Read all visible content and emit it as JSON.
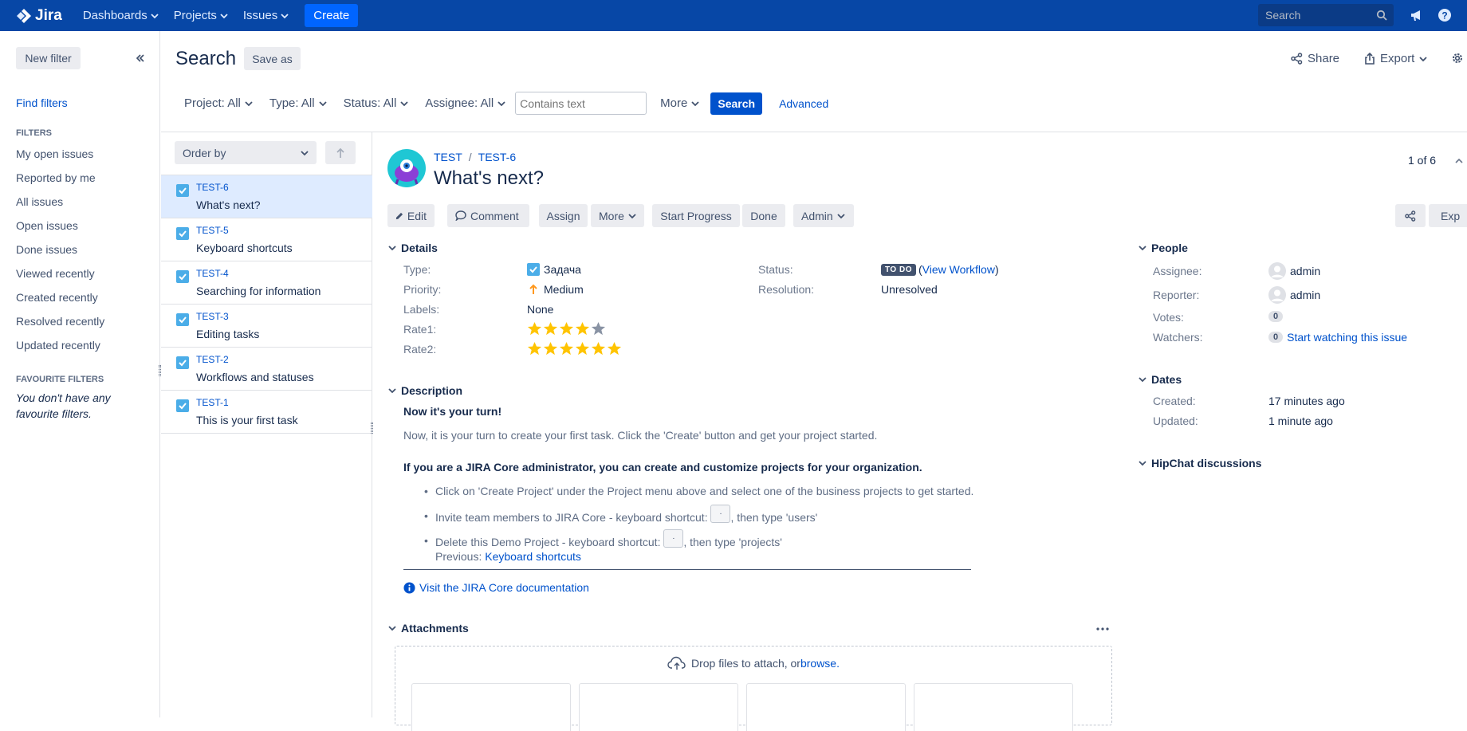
{
  "topnav": {
    "logo": "Jira",
    "dashboards": "Dashboards",
    "projects": "Projects",
    "issues": "Issues",
    "create": "Create",
    "search_placeholder": "Search"
  },
  "sidebar": {
    "new_filter": "New filter",
    "find_filters": "Find filters",
    "filters_heading": "FILTERS",
    "items": [
      "My open issues",
      "Reported by me",
      "All issues",
      "Open issues",
      "Done issues",
      "Viewed recently",
      "Created recently",
      "Resolved recently",
      "Updated recently"
    ],
    "favourite_heading": "FAVOURITE FILTERS",
    "favourite_empty": "You don't have any favourite filters."
  },
  "search": {
    "title": "Search",
    "save_as": "Save as",
    "share": "Share",
    "export": "Export",
    "filters": {
      "project": "Project: All",
      "type": "Type: All",
      "status": "Status: All",
      "assignee": "Assignee: All",
      "text_placeholder": "Contains text",
      "more": "More",
      "search": "Search",
      "advanced": "Advanced"
    },
    "order_by": "Order by"
  },
  "issues": [
    {
      "key": "TEST-6",
      "summary": "What's next?",
      "selected": true
    },
    {
      "key": "TEST-5",
      "summary": "Keyboard shortcuts",
      "selected": false
    },
    {
      "key": "TEST-4",
      "summary": "Searching for information",
      "selected": false
    },
    {
      "key": "TEST-3",
      "summary": "Editing tasks",
      "selected": false
    },
    {
      "key": "TEST-2",
      "summary": "Workflows and statuses",
      "selected": false
    },
    {
      "key": "TEST-1",
      "summary": "This is your first task",
      "selected": false
    }
  ],
  "issue": {
    "project": "TEST",
    "key": "TEST-6",
    "title": "What's next?",
    "pager": "1 of 6",
    "actions": {
      "edit": "Edit",
      "comment": "Comment",
      "assign": "Assign",
      "more": "More",
      "start_progress": "Start Progress",
      "done": "Done",
      "admin": "Admin",
      "export_partial": "Exp"
    },
    "details": {
      "heading": "Details",
      "type_label": "Type:",
      "type_value": "Задача",
      "priority_label": "Priority:",
      "priority_value": "Medium",
      "labels_label": "Labels:",
      "labels_value": "None",
      "rate1_label": "Rate1:",
      "rate1_value": 4,
      "rate2_label": "Rate2:",
      "rate2_value": 6,
      "status_label": "Status:",
      "status_value": "TO DO",
      "view_workflow": "View Workflow",
      "resolution_label": "Resolution:",
      "resolution_value": "Unresolved"
    },
    "description": {
      "heading": "Description",
      "line1": "Now it's your turn!",
      "line2": "Now, it is your turn to create your first task. Click the 'Create' button and get your project started.",
      "line3": "If you are a JIRA Core administrator, you can create and customize projects for your organization.",
      "bullet1": "Click on 'Create Project' under the Project menu above and select one of the business projects to get started.",
      "bullet2_pre": "Invite team members to JIRA Core - keyboard shortcut: ",
      "bullet2_post": ", then type 'users'",
      "bullet3_pre": "Delete this Demo Project - keyboard shortcut: ",
      "bullet3_post": ", then type 'projects'",
      "kbd": ".",
      "previous_label": "Previous: ",
      "previous_link": "Keyboard shortcuts",
      "doc_link": "Visit the JIRA Core documentation"
    },
    "attachments": {
      "heading": "Attachments",
      "drop_text": "Drop files to attach, or ",
      "browse": "browse."
    },
    "people": {
      "heading": "People",
      "assignee_label": "Assignee:",
      "assignee": "admin",
      "reporter_label": "Reporter:",
      "reporter": "admin",
      "votes_label": "Votes:",
      "votes": "0",
      "watchers_label": "Watchers:",
      "watchers": "0",
      "watch_link": "Start watching this issue"
    },
    "dates": {
      "heading": "Dates",
      "created_label": "Created:",
      "created": "17 minutes ago",
      "updated_label": "Updated:",
      "updated": "1 minute ago"
    },
    "hipchat": {
      "heading": "HipChat discussions"
    }
  },
  "colors": {
    "topbar": "#0747a6",
    "link": "#0052cc",
    "selected_row": "#deebff",
    "star": "#ffc400",
    "star_empty": "#8993a4"
  }
}
